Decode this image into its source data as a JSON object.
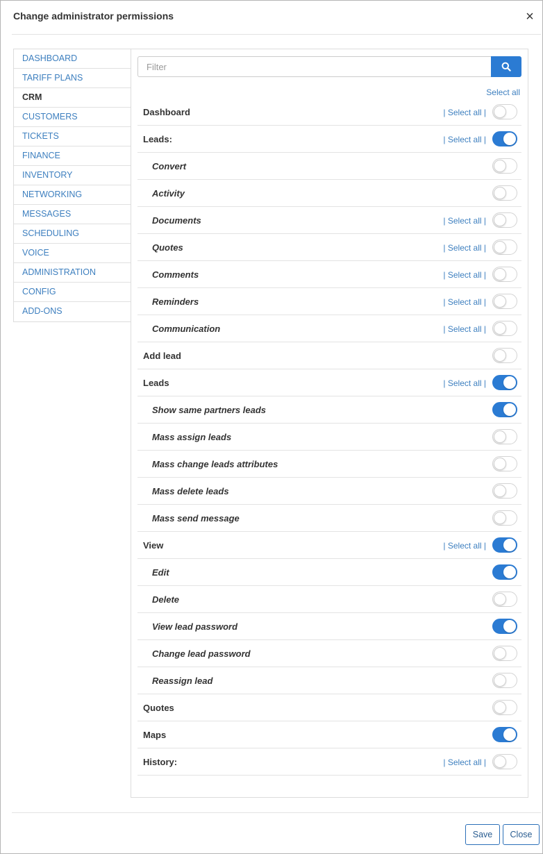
{
  "dialog": {
    "title": "Change administrator permissions",
    "close_symbol": "×"
  },
  "sidebar": {
    "items": [
      {
        "label": "DASHBOARD",
        "active": false
      },
      {
        "label": "TARIFF PLANS",
        "active": false
      },
      {
        "label": "CRM",
        "active": true
      },
      {
        "label": "CUSTOMERS",
        "active": false
      },
      {
        "label": "TICKETS",
        "active": false
      },
      {
        "label": "FINANCE",
        "active": false
      },
      {
        "label": "INVENTORY",
        "active": false
      },
      {
        "label": "NETWORKING",
        "active": false
      },
      {
        "label": "MESSAGES",
        "active": false
      },
      {
        "label": "SCHEDULING",
        "active": false
      },
      {
        "label": "VOICE",
        "active": false
      },
      {
        "label": "ADMINISTRATION",
        "active": false
      },
      {
        "label": "CONFIG",
        "active": false
      },
      {
        "label": "ADD-ONS",
        "active": false
      }
    ]
  },
  "filter": {
    "placeholder": "Filter",
    "search_icon": "search-icon"
  },
  "select_all_label": "Select all",
  "row_select_all_label": "| Select all |",
  "permissions": [
    {
      "label": "Dashboard",
      "level": "top",
      "select_all": true,
      "enabled": false
    },
    {
      "label": "Leads:",
      "level": "top",
      "select_all": true,
      "enabled": true
    },
    {
      "label": "Convert",
      "level": "sub",
      "select_all": false,
      "enabled": false
    },
    {
      "label": "Activity",
      "level": "sub",
      "select_all": false,
      "enabled": false
    },
    {
      "label": "Documents",
      "level": "sub",
      "select_all": true,
      "enabled": false
    },
    {
      "label": "Quotes",
      "level": "sub",
      "select_all": true,
      "enabled": false
    },
    {
      "label": "Comments",
      "level": "sub",
      "select_all": true,
      "enabled": false
    },
    {
      "label": "Reminders",
      "level": "sub",
      "select_all": true,
      "enabled": false
    },
    {
      "label": "Communication",
      "level": "sub",
      "select_all": true,
      "enabled": false
    },
    {
      "label": "Add lead",
      "level": "top",
      "select_all": false,
      "enabled": false
    },
    {
      "label": "Leads",
      "level": "top",
      "select_all": true,
      "enabled": true
    },
    {
      "label": "Show same partners leads",
      "level": "sub",
      "select_all": false,
      "enabled": true
    },
    {
      "label": "Mass assign leads",
      "level": "sub",
      "select_all": false,
      "enabled": false
    },
    {
      "label": "Mass change leads attributes",
      "level": "sub",
      "select_all": false,
      "enabled": false
    },
    {
      "label": "Mass delete leads",
      "level": "sub",
      "select_all": false,
      "enabled": false
    },
    {
      "label": "Mass send message",
      "level": "sub",
      "select_all": false,
      "enabled": false
    },
    {
      "label": "View",
      "level": "top",
      "select_all": true,
      "enabled": true
    },
    {
      "label": "Edit",
      "level": "sub",
      "select_all": false,
      "enabled": true
    },
    {
      "label": "Delete",
      "level": "sub",
      "select_all": false,
      "enabled": false
    },
    {
      "label": "View lead password",
      "level": "sub",
      "select_all": false,
      "enabled": true
    },
    {
      "label": "Change lead password",
      "level": "sub",
      "select_all": false,
      "enabled": false
    },
    {
      "label": "Reassign lead",
      "level": "sub",
      "select_all": false,
      "enabled": false
    },
    {
      "label": "Quotes",
      "level": "top",
      "select_all": false,
      "enabled": false
    },
    {
      "label": "Maps",
      "level": "top",
      "select_all": false,
      "enabled": true
    },
    {
      "label": "History:",
      "level": "top",
      "select_all": true,
      "enabled": false
    }
  ],
  "footer": {
    "save_label": "Save",
    "close_label": "Close"
  },
  "colors": {
    "accent": "#2b7bd3",
    "link": "#3d7fbf"
  }
}
